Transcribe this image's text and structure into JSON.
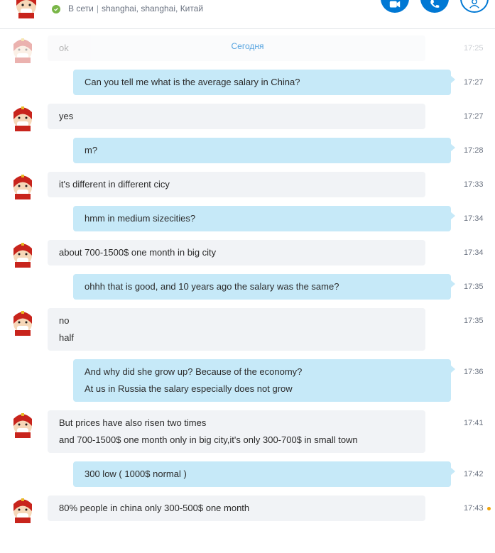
{
  "header": {
    "status": "В сети",
    "location": "shanghai, shanghai, Китай",
    "buttons": [
      {
        "icon": "video-call-icon"
      },
      {
        "icon": "phone-call-icon"
      },
      {
        "icon": "add-contact-icon"
      }
    ]
  },
  "chat": {
    "date_separator": "Сегодня",
    "messages": [
      {
        "dir": "in",
        "lines": [
          "ok"
        ],
        "time": "17:25",
        "faded": true
      },
      {
        "dir": "out",
        "lines": [
          "Can you tell me what is the average salary in China?"
        ],
        "time": "17:27"
      },
      {
        "dir": "in",
        "lines": [
          "yes"
        ],
        "time": "17:27"
      },
      {
        "dir": "out",
        "lines": [
          "m?"
        ],
        "time": "17:28"
      },
      {
        "dir": "in",
        "lines": [
          "it's different in different cicy"
        ],
        "time": "17:33"
      },
      {
        "dir": "out",
        "lines": [
          "hmm in medium sizecities?"
        ],
        "time": "17:34"
      },
      {
        "dir": "in",
        "lines": [
          "about 700-1500$ one month in big city"
        ],
        "time": "17:34"
      },
      {
        "dir": "out",
        "lines": [
          "ohhh that is good, and 10 years ago the salary was the same?"
        ],
        "time": "17:35"
      },
      {
        "dir": "in",
        "lines": [
          "no",
          "half"
        ],
        "time": "17:35"
      },
      {
        "dir": "out",
        "lines": [
          "And why did she grow up? Because of the economy?",
          "At us in Russia the salary especially does not grow"
        ],
        "time": "17:36"
      },
      {
        "dir": "in",
        "lines": [
          "But prices have also risen two times",
          "and 700-1500$ one month only  in big city,it's only 300-700$ in small town"
        ],
        "time": "17:41"
      },
      {
        "dir": "out",
        "lines": [
          "300 low ( 1000$ normal )"
        ],
        "time": "17:42"
      },
      {
        "dir": "in",
        "lines": [
          "80% people in china only 300-500$ one month"
        ],
        "time": "17:43",
        "unread": true
      }
    ]
  }
}
